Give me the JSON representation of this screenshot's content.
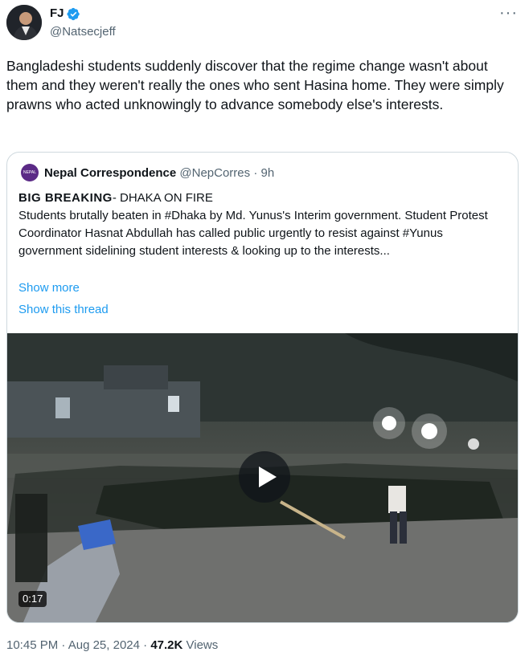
{
  "author": {
    "name": "FJ",
    "handle": "@Natsecjeff",
    "verified": true
  },
  "tweet": {
    "text": "Bangladeshi students suddenly discover that the regime change wasn't about them and they weren't really the ones who sent Hasina home. They were simply prawns who acted unknowingly to advance somebody else's interests."
  },
  "quote": {
    "avatar_text": "NEPAL",
    "name": "Nepal Correspondence",
    "handle": "@NepCorres",
    "separator": "·",
    "time": "9h",
    "lead": "BIG BREAKING",
    "lead_rest": "- DHAKA ON FIRE",
    "body": "Students brutally beaten in #Dhaka by Md. Yunus's Interim government. Student Protest Coordinator Hasnat Abdullah has called public urgently to resist against #Yunus government sidelining student interests & looking up to the interests...",
    "show_more": "Show more",
    "show_thread": "Show this thread",
    "video_duration": "0:17"
  },
  "meta": {
    "time": "10:45 PM",
    "sep1": " · ",
    "date": "Aug 25, 2024",
    "sep2": " · ",
    "views_count": "47.2K",
    "views_label": " Views"
  },
  "colors": {
    "link": "#1d9bf0",
    "verified": "#1d9bf0",
    "muted": "#536471"
  },
  "icons": [
    "verified-badge-icon",
    "more-options-icon",
    "play-icon"
  ]
}
